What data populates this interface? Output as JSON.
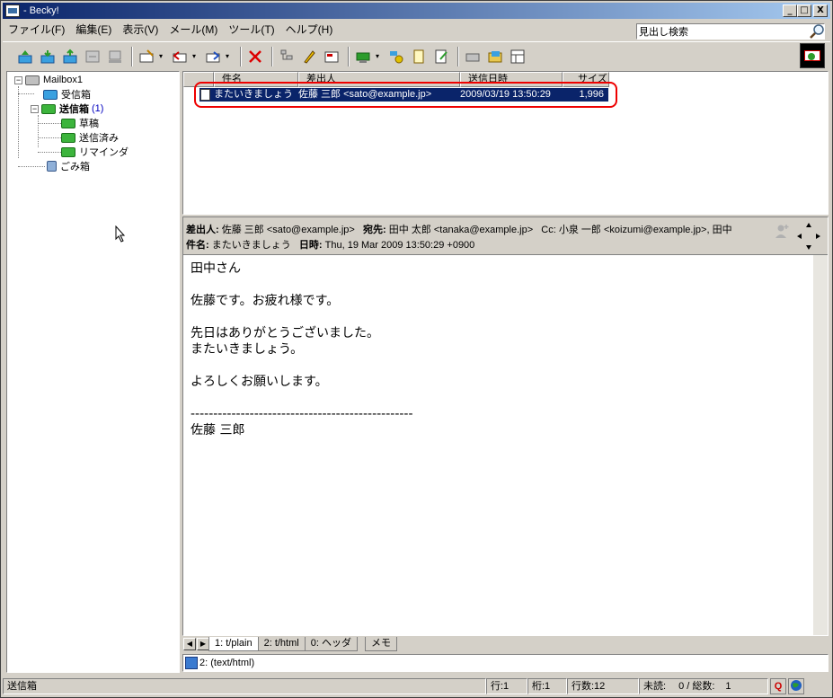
{
  "window": {
    "title": "- Becky!",
    "minimize": "_",
    "maximize": "□",
    "close": "X"
  },
  "menu": [
    "ファイル(F)",
    "編集(E)",
    "表示(V)",
    "メール(M)",
    "ツール(T)",
    "ヘルプ(H)"
  ],
  "header_search": {
    "value": "見出し検索"
  },
  "folders": {
    "root": "Mailbox1",
    "inbox": "受信箱",
    "outbox": "送信箱",
    "outbox_count": "(1)",
    "drafts": "草稿",
    "sent": "送信済み",
    "reminder": "リマインダ",
    "trash": "ごみ箱"
  },
  "list": {
    "columns": [
      "件名",
      "差出人",
      "送信日時",
      "サイズ"
    ],
    "rows": [
      {
        "subject": "またいきましょう",
        "from": "佐藤 三郎 <sato@example.jp>",
        "date": "2009/03/19 13:50:29",
        "size": "1,996"
      }
    ]
  },
  "preview": {
    "from_label": "差出人:",
    "from": "佐藤 三郎 <sato@example.jp>",
    "to_label": "宛先:",
    "to": "田中 太郎 <tanaka@example.jp>",
    "cc": "Cc: 小泉 一郎 <koizumi@example.jp>, 田中",
    "subject_label": "件名:",
    "subject": "またいきましょう",
    "date_label": "日時:",
    "date": "Thu, 19 Mar 2009 13:50:29 +0900",
    "body": "田中さん\n\n佐藤です。お疲れ様です。\n\n先日はありがとうございました。\nまたいきましょう。\n\nよろしくお願いします。\n\n-------------------------------------------------\n佐藤 三郎"
  },
  "tabs": [
    "1: t/plain",
    "2: t/html",
    "0: ヘッダ",
    "メモ"
  ],
  "attachment": "2: (text/html)",
  "status": {
    "folder": "送信箱",
    "line": "行:1",
    "col": "桁:1",
    "lines": "行数:12",
    "unread": "未読:",
    "counts": "0 / 総数:",
    "total": "1",
    "q_label": "Q"
  },
  "colors": {
    "selection": "#0a246a",
    "highlight_box": "#e00000",
    "title_gradient_start": "#0a246a"
  }
}
